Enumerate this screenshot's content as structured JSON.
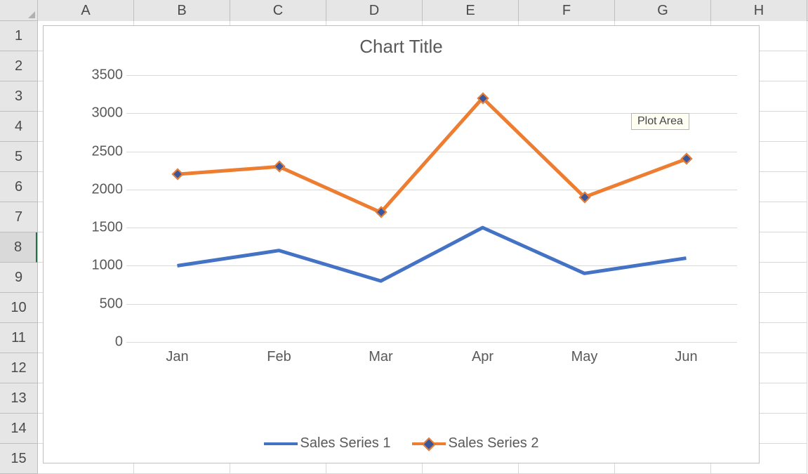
{
  "columns": [
    "A",
    "B",
    "C",
    "D",
    "E",
    "F",
    "G",
    "H"
  ],
  "rows": [
    "1",
    "2",
    "3",
    "4",
    "5",
    "6",
    "7",
    "8",
    "9",
    "10",
    "11",
    "12",
    "13",
    "14",
    "15"
  ],
  "active_row": 8,
  "tooltip": {
    "label": "Plot Area"
  },
  "chart_data": {
    "type": "line",
    "title": "Chart Title",
    "xlabel": "",
    "ylabel": "",
    "categories": [
      "Jan",
      "Feb",
      "Mar",
      "Apr",
      "May",
      "Jun"
    ],
    "series": [
      {
        "name": "Sales Series 1",
        "values": [
          1000,
          1200,
          800,
          1500,
          900,
          1100
        ],
        "color": "#4472c4",
        "markers": false
      },
      {
        "name": "Sales Series 2",
        "values": [
          2200,
          2300,
          1700,
          3200,
          1900,
          2400
        ],
        "color": "#ed7d31",
        "markers": true
      }
    ],
    "ylim": [
      0,
      3500
    ],
    "y_ticks": [
      0,
      500,
      1000,
      1500,
      2000,
      2500,
      3000,
      3500
    ],
    "grid": true,
    "legend_position": "bottom"
  }
}
